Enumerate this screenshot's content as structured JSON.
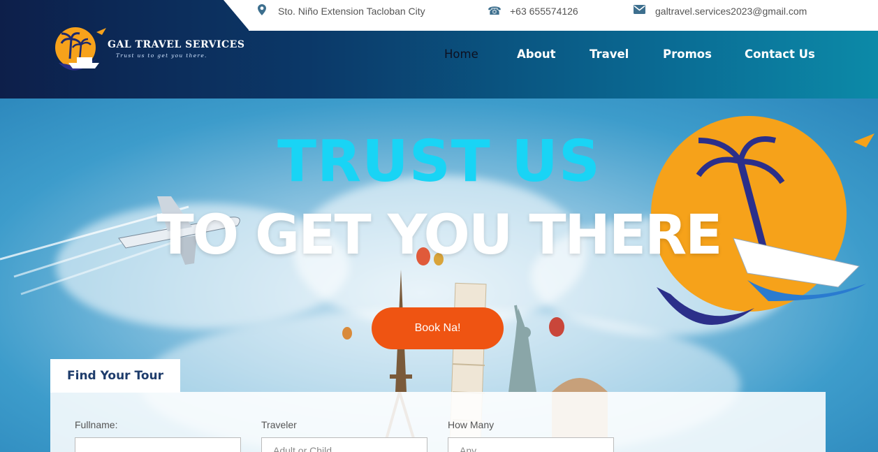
{
  "topbar": {
    "address": "Sto. Niño Extension Tacloban City",
    "phone": "+63 655574126",
    "email": "galtravel.services2023@gmail.com",
    "address_icon": "map-pin-icon",
    "phone_icon": "phone-icon",
    "email_icon": "envelope-icon"
  },
  "brand": {
    "name": "GAL TRAVEL SERVICES",
    "tagline": "Trust us to get you there."
  },
  "nav": [
    {
      "label": "Home",
      "active": true
    },
    {
      "label": "About"
    },
    {
      "label": "Travel"
    },
    {
      "label": "Promos"
    },
    {
      "label": "Contact Us"
    }
  ],
  "hero": {
    "headline_1": "TRUST US",
    "headline_2": "TO GET YOU THERE",
    "cta": "Book Na!"
  },
  "form": {
    "tab_label": "Find Your Tour",
    "fields": [
      {
        "label": "Fullname:",
        "placeholder": ""
      },
      {
        "label": "Traveler",
        "placeholder": "Adult or Child"
      },
      {
        "label": "How Many",
        "placeholder": "Any"
      }
    ]
  },
  "colors": {
    "accent_cyan": "#19d4f5",
    "cta_orange": "#ef5412",
    "navy": "#0d1f4a"
  }
}
